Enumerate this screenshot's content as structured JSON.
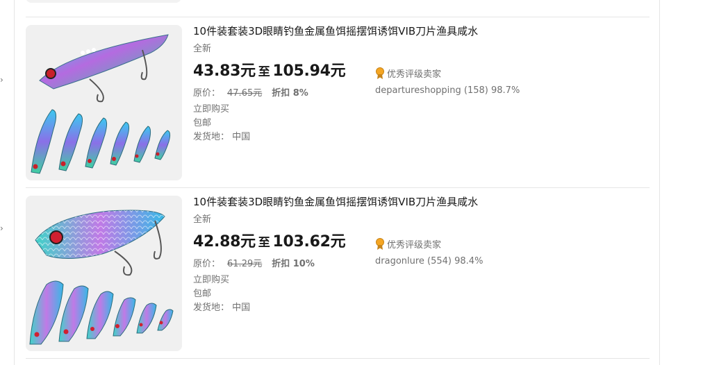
{
  "listings": [
    {
      "title": "10件装套装3D眼睛钓鱼金属鱼饵摇摆饵诱饵VIB刀片渔具咸水",
      "condition": "全新",
      "price_low": "43.83元",
      "price_sep": "至",
      "price_high": "105.94元",
      "orig_label": "原价：",
      "orig_price": "47.65元",
      "discount": "折扣 8%",
      "buy_now": "立即购买",
      "shipping": "包邮",
      "location": "发货地： 中国",
      "badge": "优秀评级卖家",
      "seller": "departureshopping (158) 98.7%"
    },
    {
      "title": "10件装套装3D眼睛钓鱼金属鱼饵摇摆饵诱饵VIB刀片渔具咸水",
      "condition": "全新",
      "price_low": "42.88元",
      "price_sep": "至",
      "price_high": "103.62元",
      "orig_label": "原价：",
      "orig_price": "61.29元",
      "discount": "折扣 10%",
      "buy_now": "立即购买",
      "shipping": "包邮",
      "location": "发货地： 中国",
      "badge": "优秀评级卖家",
      "seller": "dragonlure (554) 98.4%"
    }
  ],
  "side_caret": "›",
  "colors": {
    "text": "#191919",
    "muted": "#707070",
    "divider": "#e5e5e5",
    "medal": "#f5a623"
  }
}
